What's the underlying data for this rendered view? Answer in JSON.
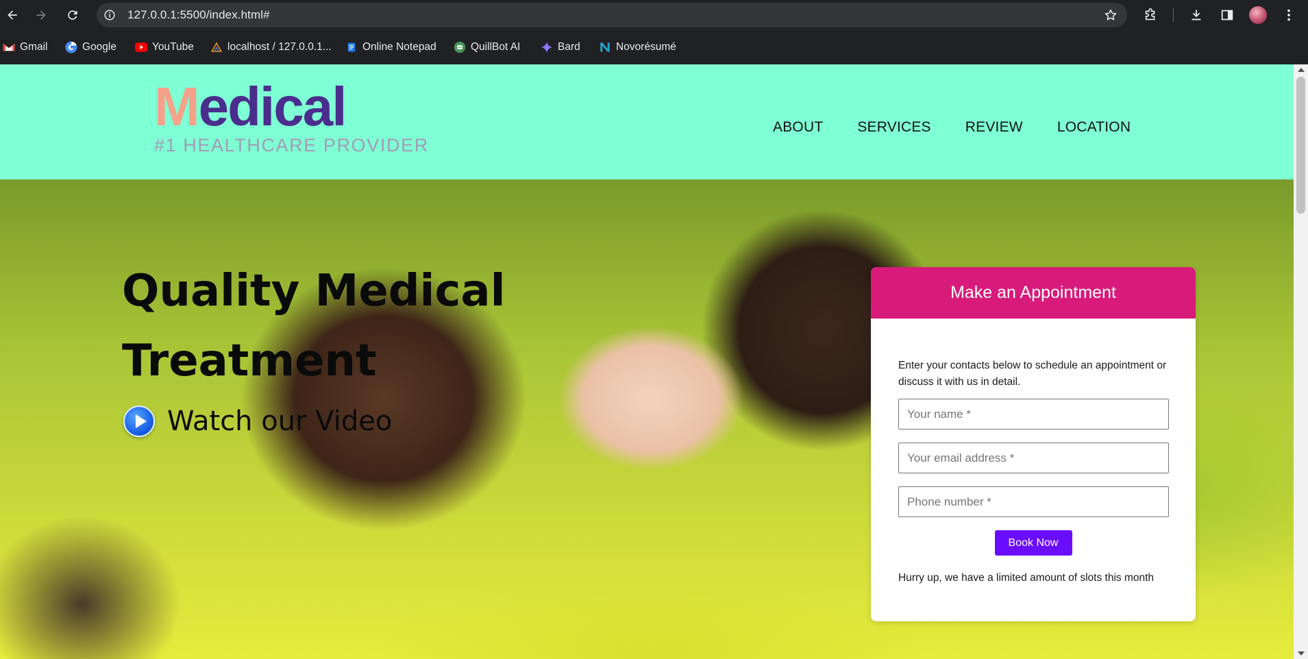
{
  "browser": {
    "url": "127.0.0.1:5500/index.html#",
    "bookmarks": [
      {
        "label": "Gmail",
        "icon": "gmail-icon"
      },
      {
        "label": "Google",
        "icon": "google-icon"
      },
      {
        "label": "YouTube",
        "icon": "youtube-icon"
      },
      {
        "label": "localhost / 127.0.0.1...",
        "icon": "phpmyadmin-icon"
      },
      {
        "label": "Online Notepad",
        "icon": "notepad-icon"
      },
      {
        "label": "QuillBot AI",
        "icon": "quillbot-icon"
      },
      {
        "label": "Bard",
        "icon": "bard-icon"
      },
      {
        "label": "Novorésumé",
        "icon": "novoresume-icon"
      }
    ]
  },
  "header": {
    "logo_first": "M",
    "logo_rest": "edical",
    "tagline": "#1 HEALTHCARE PROVIDER",
    "nav": [
      "ABOUT",
      "SERVICES",
      "REVIEW",
      "LOCATION"
    ]
  },
  "hero": {
    "title_line1": "Quality Medical",
    "title_line2": "Treatment",
    "video_label": "Watch our Video"
  },
  "appointment": {
    "title": "Make an Appointment",
    "description": "Enter your contacts below to schedule an appointment or discuss it with us in detail.",
    "name_placeholder": "Your name *",
    "email_placeholder": "Your email address *",
    "phone_placeholder": "Phone number *",
    "button": "Book Now",
    "footer": "Hurry up, we have a limited amount of slots this month"
  },
  "colors": {
    "header_bg": "#7fffd4",
    "logo_m": "#f6a18a",
    "logo_text": "#4a2d8c",
    "card_header": "#d81b7a",
    "button": "#6a0dff"
  }
}
